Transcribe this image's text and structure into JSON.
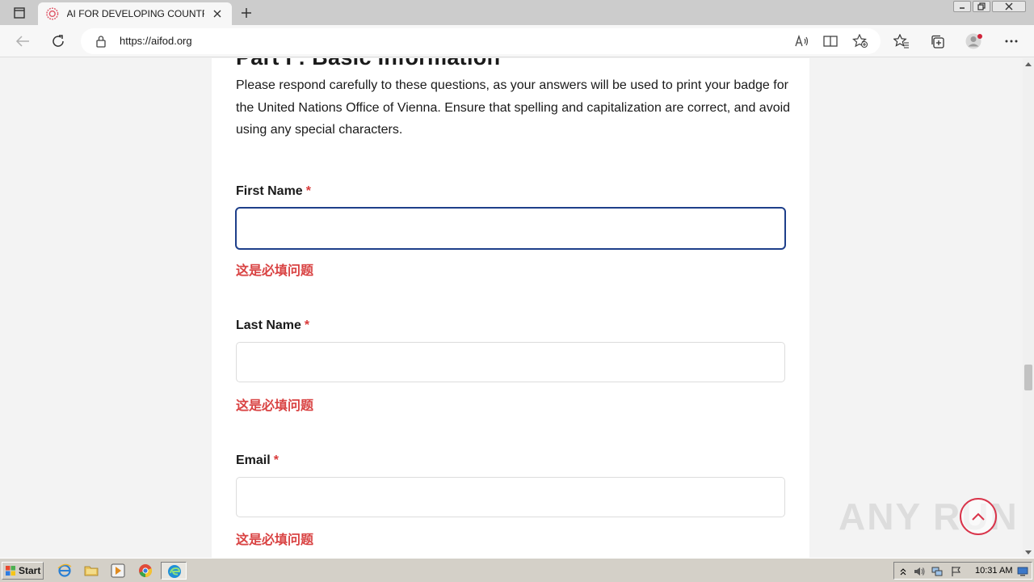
{
  "browser": {
    "tab_title": "AI FOR DEVELOPING COUNTRIES",
    "url": "https://aifod.org"
  },
  "form": {
    "section_title": "Part I : Basic Information",
    "intro": "Please respond carefully to these questions, as your answers will be used to print your badge for the United Nations Office of Vienna. Ensure that spelling and capitalization are correct, and avoid using any special characters.",
    "required_marker": "*",
    "fields": [
      {
        "label": "First Name",
        "value": "",
        "error": "这是必填问题"
      },
      {
        "label": "Last Name",
        "value": "",
        "error": "这是必填问题"
      },
      {
        "label": "Email",
        "value": "",
        "error": "这是必填问题"
      }
    ]
  },
  "overlay": {
    "watermark": "ANY RUN"
  },
  "taskbar": {
    "start_label": "Start",
    "clock": "10:31 AM"
  },
  "colors": {
    "accent_focus": "#1e3f8a",
    "error_red": "#d94343",
    "scrolltop_ring": "#d9344a"
  }
}
